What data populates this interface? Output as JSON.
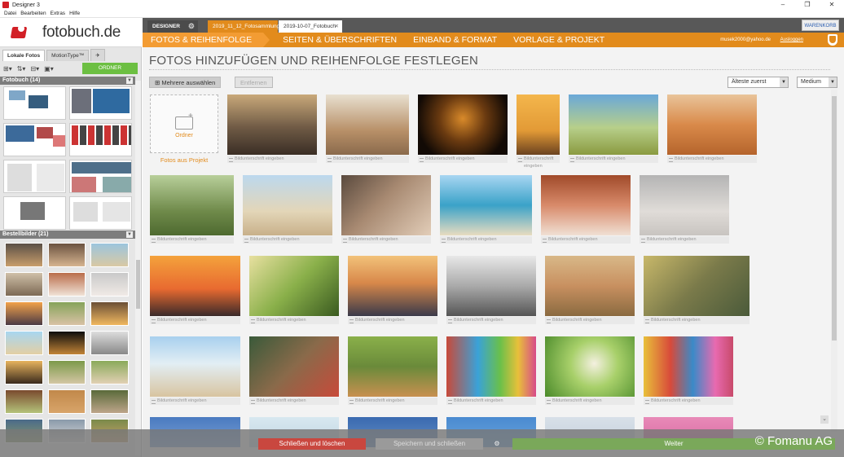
{
  "window": {
    "title": "Designer 3",
    "minimize": "–",
    "restore": "❐",
    "close": "✕"
  },
  "menu": [
    "Datei",
    "Bearbeiten",
    "Extras",
    "Hilfe"
  ],
  "logo": {
    "text": "fotobuch.de"
  },
  "left": {
    "tabs": [
      "Lokale Fotos",
      "MotionType™"
    ],
    "order_manager": "ORDNER MANAGER",
    "section_fotobuch": "Fotobuch (14)",
    "section_bestell": "Bestellbilder (21)"
  },
  "top": {
    "designer_tab": "DESIGNER",
    "doc_tabs": [
      "2019_11_12_Fotosammlung",
      "2019-10-07_Fotobuch"
    ],
    "cart": "WARENKORB",
    "email": "musek2000@yahoo.de",
    "logout": "Ausloggen"
  },
  "nav": {
    "items": [
      "FOTOS & REIHENFOLGE",
      "SEITEN & ÜBERSCHRIFTEN",
      "EINBAND & FORMAT",
      "VORLAGE & PROJEKT"
    ]
  },
  "content": {
    "title": "FOTOS HINZUFÜGEN UND REIHENFOLGE FESTLEGEN",
    "select_multiple": "Mehrere auswählen",
    "remove": "Entfernen",
    "sort": "Älteste zuerst",
    "size": "Medium",
    "folder_label": "Ordner",
    "folder_caption": "Fotos aus Projekt",
    "caption_placeholder": "Bildunterschrift eingeben"
  },
  "bottom": {
    "close_delete": "Schließen und löschen",
    "save_close": "Speichern und schließen",
    "next": "Weiter",
    "copyright": "© Fomanu AG"
  },
  "colors": {
    "accent": "#e28b1c",
    "brand": "#d21f26",
    "green": "#6cbf42",
    "danger": "#c9473f"
  }
}
